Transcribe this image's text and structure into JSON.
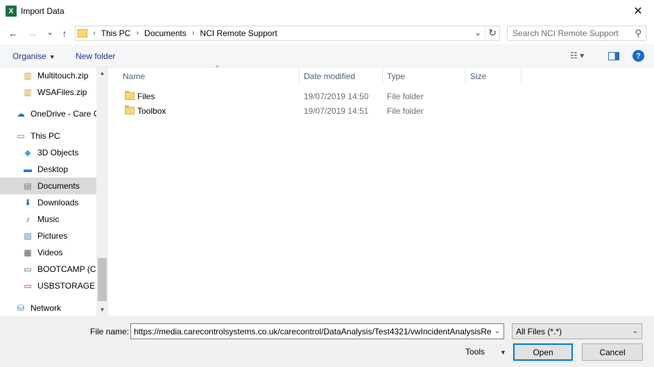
{
  "window": {
    "title": "Import Data",
    "app_icon": "X",
    "close_glyph": "✕"
  },
  "navigation": {
    "back_glyph": "←",
    "forward_glyph": "→",
    "recent_glyph": "⌄",
    "up_glyph": "↑",
    "breadcrumb": [
      "This PC",
      "Documents",
      "NCI Remote Support"
    ],
    "separator": "›",
    "dropdown_glyph": "⌄",
    "refresh_glyph": "↻",
    "search_placeholder": "Search NCI Remote Support",
    "search_glyph": "⚲"
  },
  "toolbar": {
    "organise_label": "Organise",
    "new_folder_label": "New folder",
    "dd_glyph": "▼",
    "view_glyph": "☷ ▾",
    "help_glyph": "?"
  },
  "nav_pane": {
    "items": [
      {
        "label": "Multitouch.zip",
        "icon": "zip-icon",
        "glyph": "▥",
        "color": "#c9a227"
      },
      {
        "label": "WSAFiles.zip",
        "icon": "zip-icon",
        "glyph": "▥",
        "color": "#c9a227"
      },
      {
        "label": "OneDrive - Care C",
        "icon": "cloud-icon",
        "glyph": "☁",
        "color": "#1f73c8"
      },
      {
        "label": "This PC",
        "icon": "computer-icon",
        "glyph": "▭",
        "color": "#2f8ed8"
      },
      {
        "label": "3D Objects",
        "icon": "cube-icon",
        "glyph": "◆",
        "color": "#3fa3d6"
      },
      {
        "label": "Desktop",
        "icon": "desktop-icon",
        "glyph": "▬",
        "color": "#1a78d0"
      },
      {
        "label": "Documents",
        "icon": "document-icon",
        "glyph": "▤",
        "color": "#6b7b8c"
      },
      {
        "label": "Downloads",
        "icon": "download-icon",
        "glyph": "⬇",
        "color": "#1f73c8"
      },
      {
        "label": "Music",
        "icon": "music-icon",
        "glyph": "♪",
        "color": "#1f73c8"
      },
      {
        "label": "Pictures",
        "icon": "pictures-icon",
        "glyph": "▨",
        "color": "#5a7fa8"
      },
      {
        "label": "Videos",
        "icon": "video-icon",
        "glyph": "▦",
        "color": "#5a5a5a"
      },
      {
        "label": "BOOTCAMP (C:)",
        "icon": "drive-icon",
        "glyph": "▭",
        "color": "#555555"
      },
      {
        "label": "USBSTORAGE (\\\\",
        "icon": "network-drive-icon",
        "glyph": "▭",
        "color": "#c0392b"
      },
      {
        "label": "Network",
        "icon": "network-icon",
        "glyph": "⛁",
        "color": "#1f73c8"
      }
    ],
    "scroll_up_glyph": "▲",
    "scroll_down_glyph": "▼"
  },
  "file_list": {
    "columns": [
      "Name",
      "Date modified",
      "Type",
      "Size"
    ],
    "sort_glyph": "^",
    "rows": [
      {
        "name": "Files",
        "date": "19/07/2019 14:50",
        "type": "File folder",
        "size": ""
      },
      {
        "name": "Toolbox",
        "date": "19/07/2019 14:51",
        "type": "File folder",
        "size": ""
      }
    ]
  },
  "footer": {
    "file_name_label": "File name:",
    "file_name_value": "https://media.carecontrolsystems.co.uk/carecontrol/DataAnalysis/Test4321/vwIncidentAnalysisRe",
    "filter_value": "All Files (*.*)",
    "dd_glyph": "⌄",
    "tools_label": "Tools",
    "tools_dd": "▼",
    "open_label": "Open",
    "cancel_label": "Cancel"
  }
}
